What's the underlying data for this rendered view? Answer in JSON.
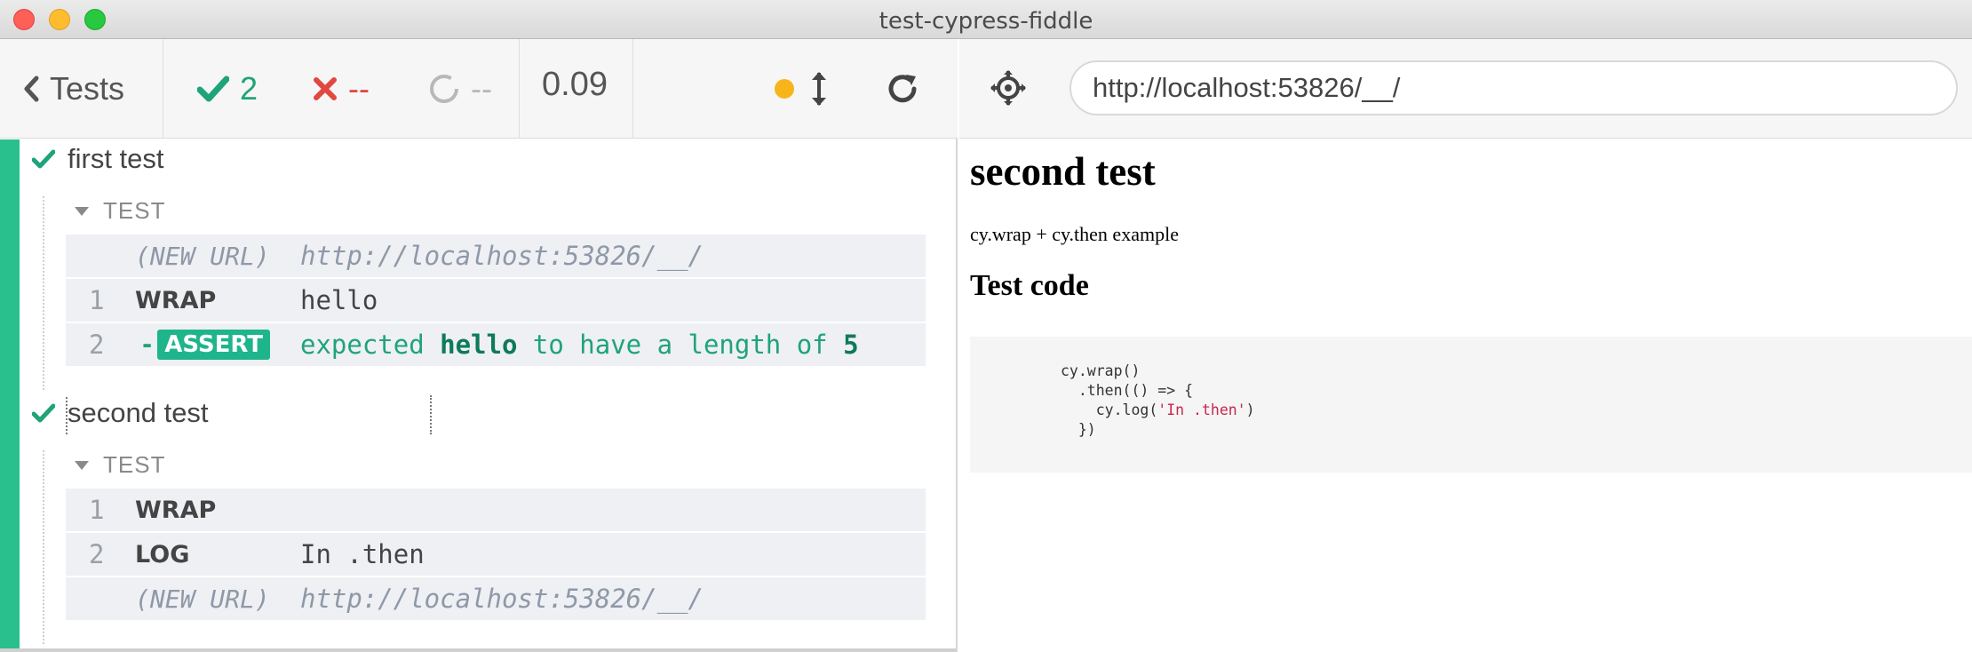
{
  "window": {
    "title": "test-cypress-fiddle"
  },
  "toolbar": {
    "tests_label": "Tests",
    "passed": "2",
    "failed": "--",
    "pending": "--",
    "duration": "0.09"
  },
  "tests": [
    {
      "title": "first test",
      "hook": "TEST",
      "commands": [
        {
          "num": "",
          "name": "(NEW URL)",
          "message": "http://localhost:53826/__/"
        },
        {
          "num": "1",
          "name": "WRAP",
          "message": "hello"
        },
        {
          "num": "2",
          "name": "ASSERT",
          "message_parts": [
            "expected ",
            "hello",
            " to have a length of ",
            "5"
          ]
        }
      ]
    },
    {
      "title": "second test",
      "hook": "TEST",
      "commands": [
        {
          "num": "1",
          "name": "WRAP",
          "message": ""
        },
        {
          "num": "2",
          "name": "LOG",
          "message": "In .then"
        },
        {
          "num": "",
          "name": "(NEW URL)",
          "message": "http://localhost:53826/__/"
        }
      ]
    }
  ],
  "aut": {
    "url": "http://localhost:53826/__/",
    "heading": "second test",
    "description": "cy.wrap + cy.then example",
    "code_heading": "Test code",
    "code": {
      "line1": "cy.wrap()",
      "line2": "  .then(() => {",
      "line3_pre": "    cy.log(",
      "line3_str": "'In .then'",
      "line3_post": ")",
      "line4": "  })"
    }
  },
  "colors": {
    "passed": "#1fa37a",
    "failed": "#e0493f",
    "suite_bar": "#29c08e",
    "indicator": "#f7b51a"
  }
}
